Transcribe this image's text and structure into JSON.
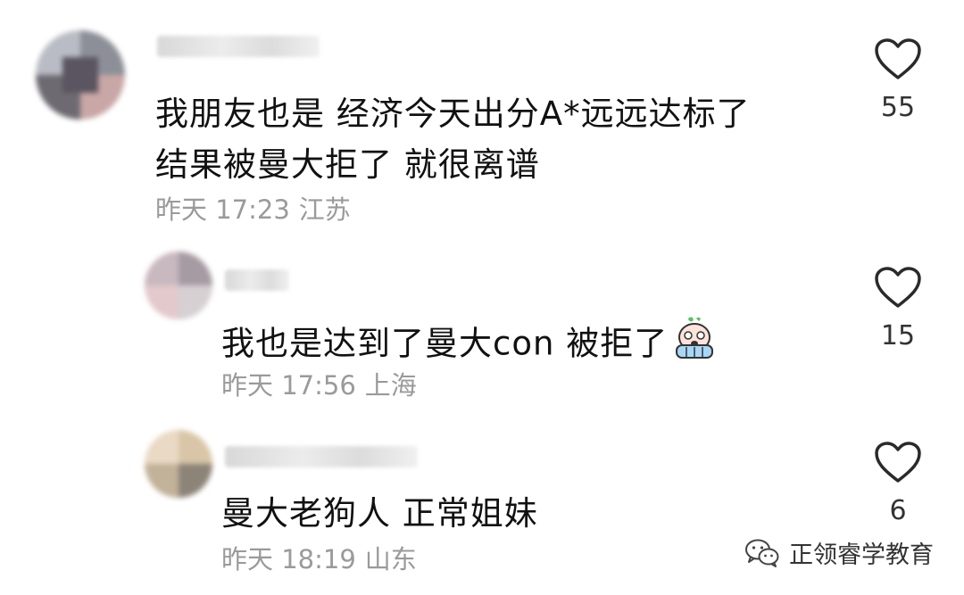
{
  "comments": [
    {
      "text_lines": [
        "我朋友也是 经济今天出分A*远远达标了",
        "结果被曼大拒了 就很离谱"
      ],
      "time": "昨天 17:23",
      "location": "江苏",
      "likes": "55"
    },
    {
      "text_lines": [
        "我也是达到了曼大con 被拒了"
      ],
      "emoji": "crying-face-emoji",
      "time": "昨天 17:56",
      "location": "上海",
      "likes": "15"
    },
    {
      "text_lines": [
        "曼大老狗人 正常姐妹"
      ],
      "time": "昨天 18:19",
      "location": "山东",
      "likes": "6"
    }
  ],
  "watermark": {
    "text": "正领睿学教育",
    "icon": "wechat-icon"
  },
  "colors": {
    "text": "#111111",
    "meta": "#9a9a9a",
    "like_count": "#333333"
  }
}
